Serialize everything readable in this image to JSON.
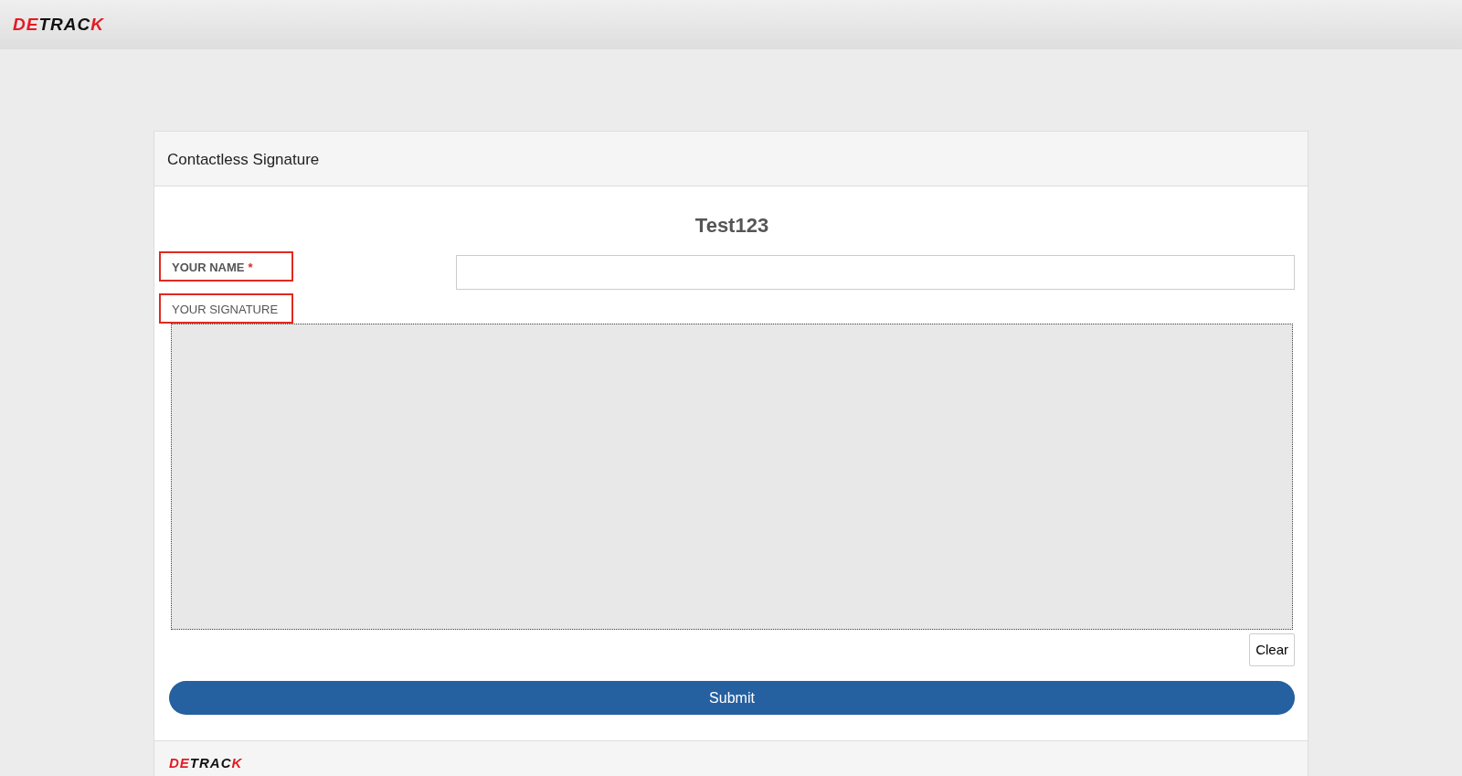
{
  "header": {
    "logo": {
      "first": "DE",
      "middle": "TRAC",
      "last": "K"
    }
  },
  "card": {
    "title": "Contactless Signature",
    "heading": "Test123",
    "fields": [
      {
        "kind": "text",
        "label": "YOUR NAME",
        "required": true,
        "required_mark": "*",
        "highlighted": true
      },
      {
        "kind": "signature",
        "label": "YOUR SIGNATURE",
        "required": false,
        "highlighted": true
      }
    ],
    "clear_button": "Clear",
    "submit_button": "Submit",
    "footer": {
      "logo": {
        "first": "DE",
        "middle": "TRAC",
        "last": "K"
      }
    }
  }
}
